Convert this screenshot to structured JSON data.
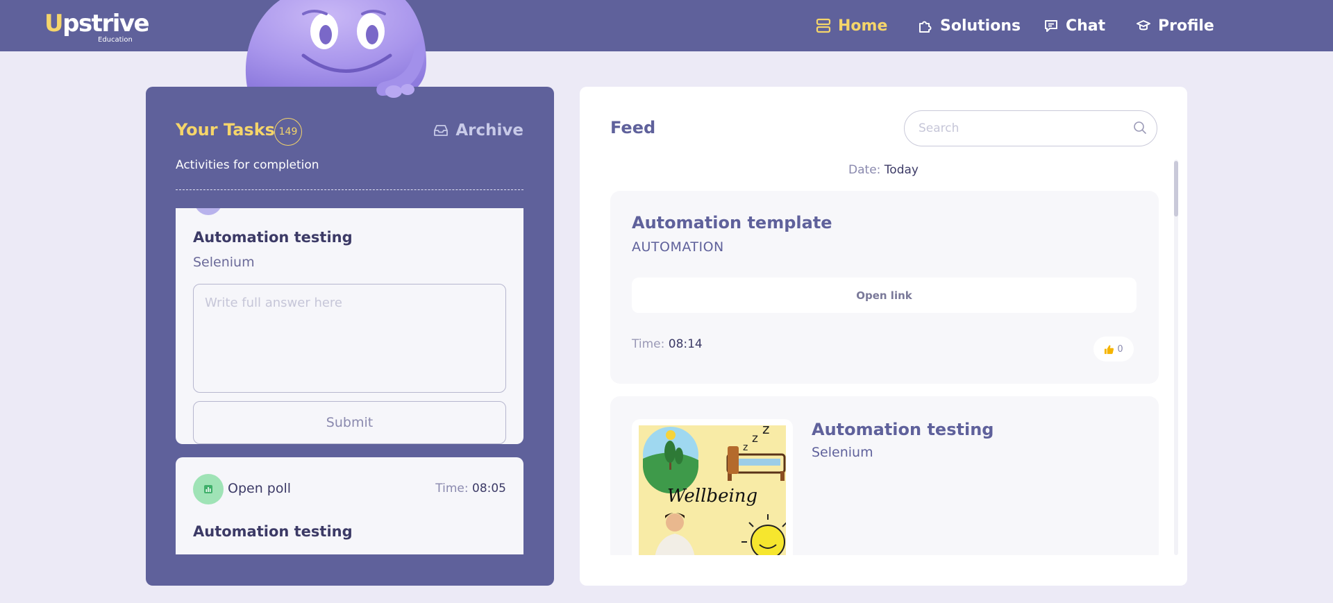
{
  "brand": {
    "logo_text": "Upstrive",
    "logo_sub": "Education",
    "accent": "#F5D56A",
    "primary": "#5F619B"
  },
  "nav": {
    "items": [
      {
        "label": "Home",
        "icon": "home-icon",
        "active": true
      },
      {
        "label": "Solutions",
        "icon": "puzzle-icon",
        "active": false
      },
      {
        "label": "Chat",
        "icon": "chat-icon",
        "active": false
      },
      {
        "label": "Profile",
        "icon": "graduation-cap-icon",
        "active": false
      }
    ]
  },
  "tasks": {
    "title": "Your Tasks",
    "count": "149",
    "archive_label": "Archive",
    "subtitle": "Activities for completion",
    "cards": [
      {
        "title": "Automation testing",
        "subtitle": "Selenium",
        "answer_placeholder": "Write full answer here",
        "submit_label": "Submit"
      },
      {
        "type_label": "Open poll",
        "time_label": "Time:",
        "time_value": "08:05",
        "title": "Automation testing"
      }
    ]
  },
  "feed": {
    "title": "Feed",
    "search_placeholder": "Search",
    "date_label": "Date:",
    "date_value": "Today",
    "items": [
      {
        "title": "Automation template",
        "tag": "AUTOMATION",
        "link_label": "Open link",
        "time_label": "Time:",
        "time_value": "08:14",
        "likes": "0"
      },
      {
        "title": "Automation testing",
        "subtitle": "Selenium",
        "image_text": "Wellbeing"
      }
    ]
  }
}
